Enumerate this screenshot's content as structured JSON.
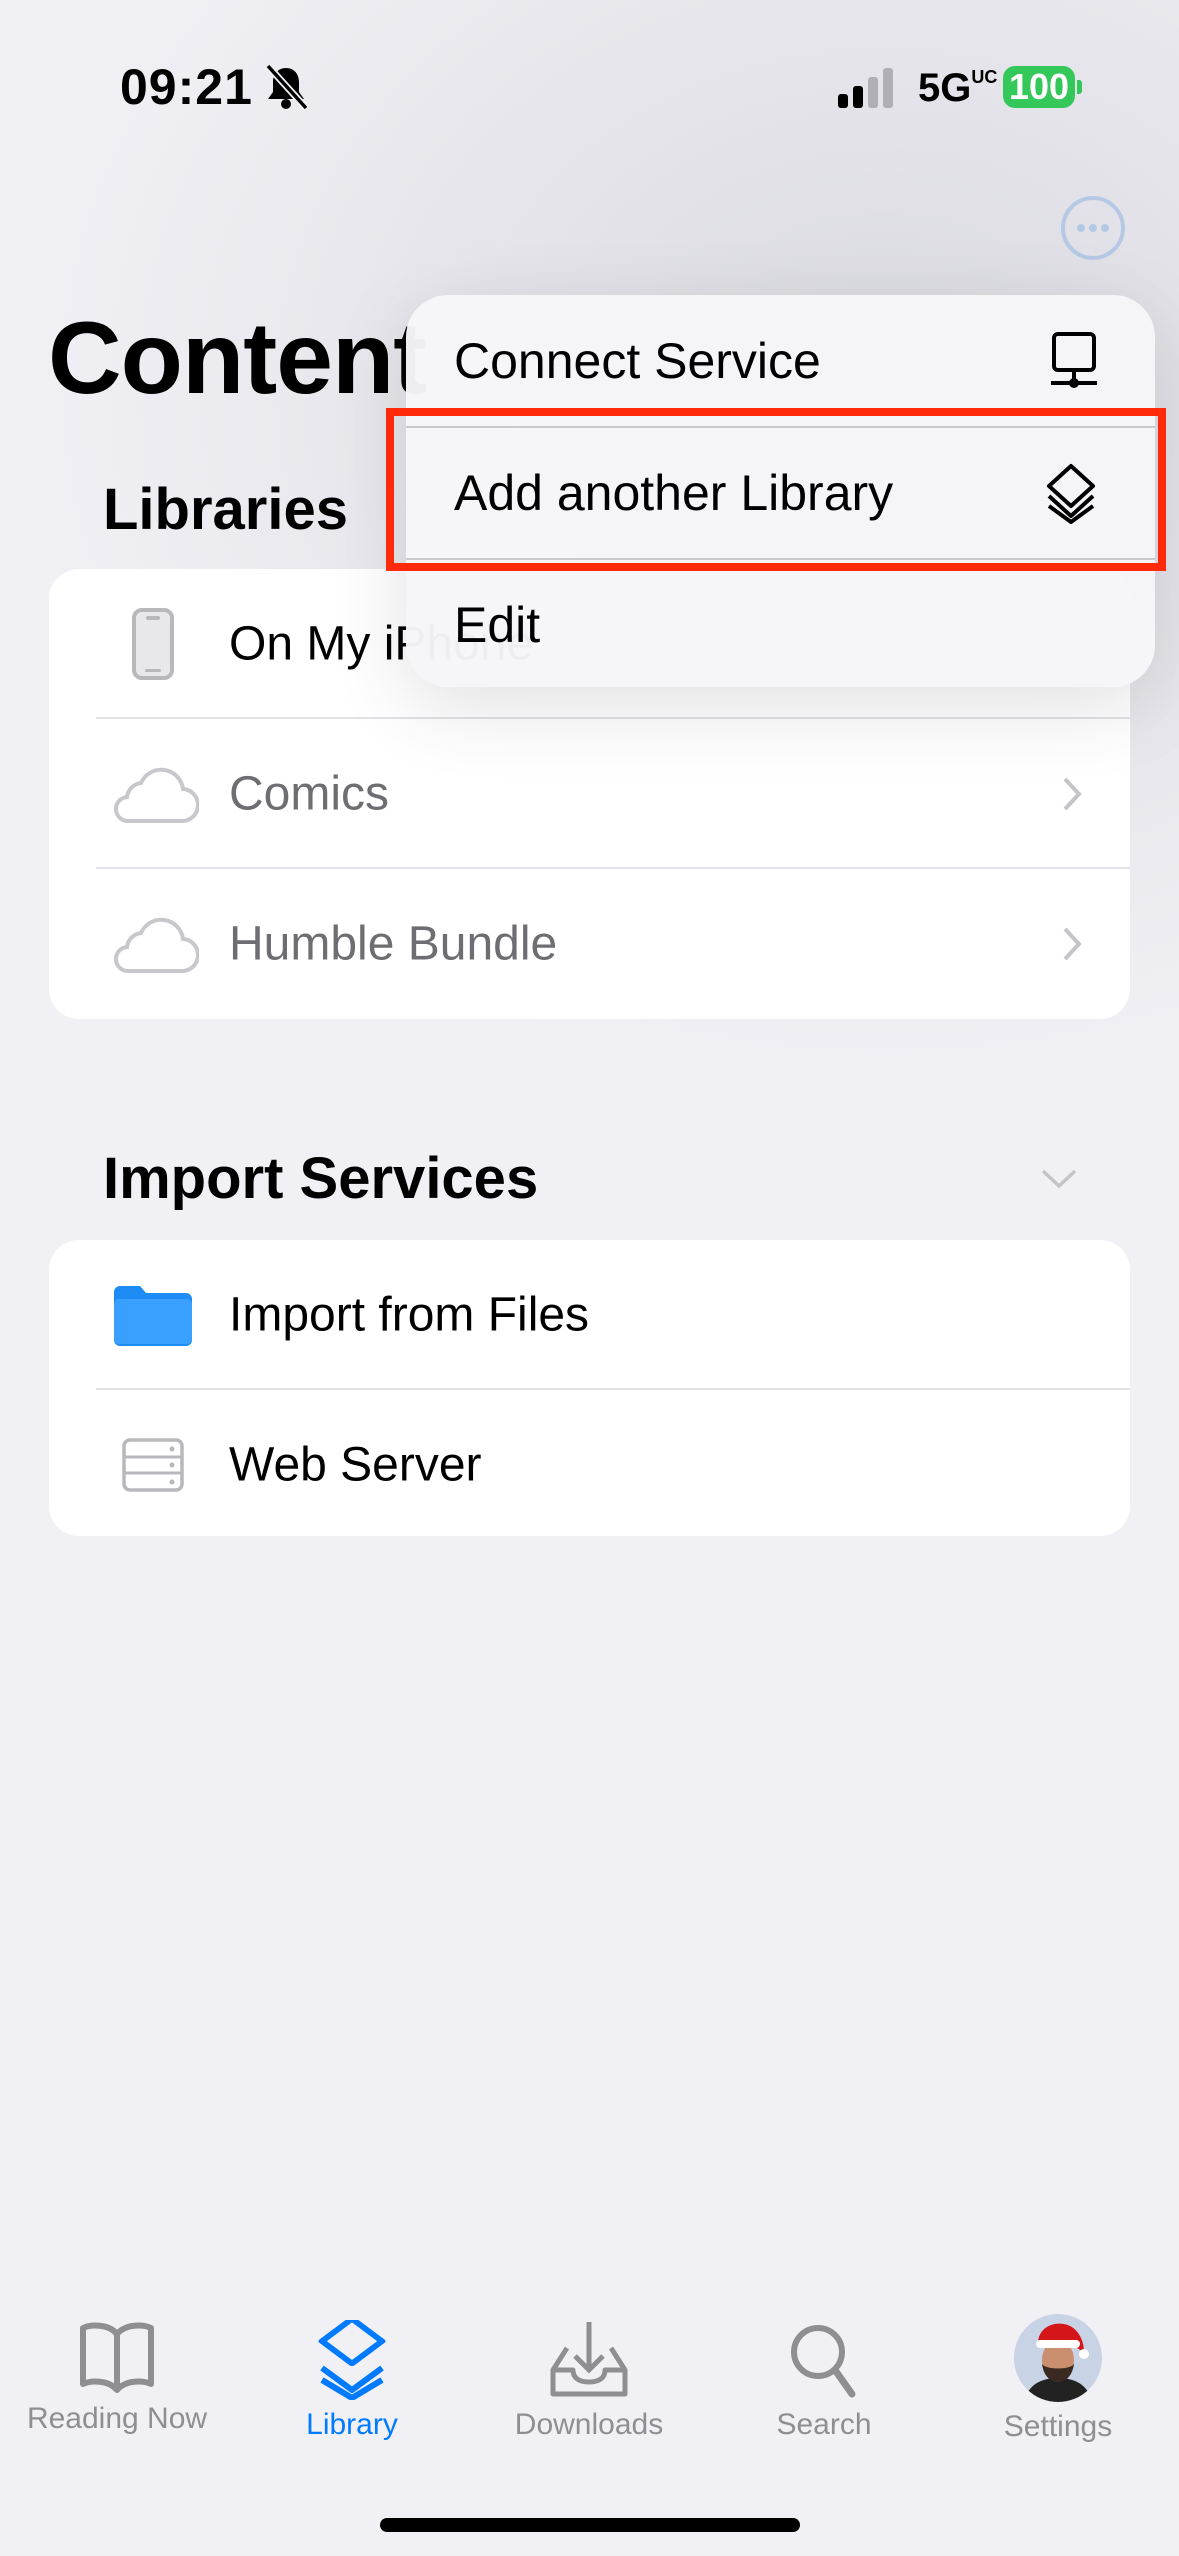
{
  "status_bar": {
    "time": "09:21",
    "network": "5G",
    "network_suffix": "UC",
    "battery": "100",
    "battery_color": "#34c759",
    "silent_icon": "bell-slash-icon"
  },
  "header": {
    "title": "Content",
    "more_icon": "ellipsis-circle-icon"
  },
  "libraries": {
    "title": "Libraries",
    "items": [
      {
        "label": "On My iPhone",
        "icon": "iphone-icon"
      },
      {
        "label": "Comics",
        "icon": "cloud-icon"
      },
      {
        "label": "Humble Bundle",
        "icon": "cloud-icon"
      }
    ]
  },
  "import_services": {
    "title": "Import Services",
    "items": [
      {
        "label": "Import from Files",
        "icon": "folder-icon"
      },
      {
        "label": "Web Server",
        "icon": "server-icon"
      }
    ]
  },
  "menu": {
    "items": [
      {
        "label": "Connect Service",
        "icon": "network-display-icon"
      },
      {
        "label": "Add another Library",
        "icon": "stack-icon",
        "highlighted": true
      },
      {
        "label": "Edit"
      }
    ]
  },
  "highlight_color": "#ff2a0a",
  "accent_color": "#007aff",
  "tab_bar": {
    "items": [
      {
        "label": "Reading Now",
        "icon": "book-icon"
      },
      {
        "label": "Library",
        "icon": "stack-icon",
        "active": true
      },
      {
        "label": "Downloads",
        "icon": "tray-download-icon"
      },
      {
        "label": "Search",
        "icon": "magnifier-icon"
      },
      {
        "label": "Settings",
        "icon": "avatar"
      }
    ]
  }
}
